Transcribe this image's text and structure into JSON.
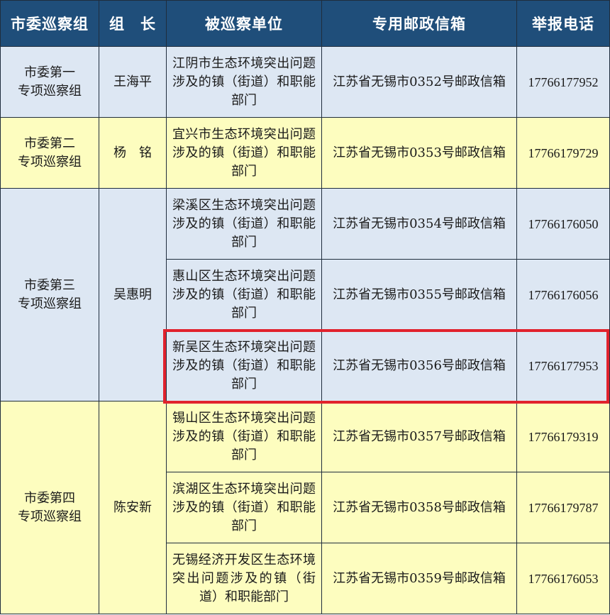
{
  "headers": {
    "group": "市委巡察组",
    "leader": "组　长",
    "unit": "被巡察单位",
    "mailbox": "专用邮政信箱",
    "phone": "举报电话"
  },
  "groups": [
    {
      "group_lines": [
        "市委第一",
        "专项巡察组"
      ],
      "leader": "王海平",
      "rows": [
        {
          "unit": "江阴市生态环境突出问题涉及的镇（街道）和职能部门",
          "mailbox": "江苏省无锡市0352号邮政信箱",
          "phone": "17766177952"
        }
      ]
    },
    {
      "group_lines": [
        "市委第二",
        "专项巡察组"
      ],
      "leader": "杨　铭",
      "rows": [
        {
          "unit": "宜兴市生态环境突出问题涉及的镇（街道）和职能部门",
          "mailbox": "江苏省无锡市0353号邮政信箱",
          "phone": "17766179729"
        }
      ]
    },
    {
      "group_lines": [
        "市委第三",
        "专项巡察组"
      ],
      "leader": "吴惠明",
      "rows": [
        {
          "unit": "梁溪区生态环境突出问题涉及的镇（街道）和职能部门",
          "mailbox": "江苏省无锡市0354号邮政信箱",
          "phone": "17766176050"
        },
        {
          "unit": "惠山区生态环境突出问题涉及的镇（街道）和职能部门",
          "mailbox": "江苏省无锡市0355号邮政信箱",
          "phone": "17766176056"
        },
        {
          "unit": "新吴区生态环境突出问题涉及的镇（街道）和职能部门",
          "mailbox": "江苏省无锡市0356号邮政信箱",
          "phone": "17766177953"
        }
      ]
    },
    {
      "group_lines": [
        "市委第四",
        "专项巡察组"
      ],
      "leader": "陈安新",
      "rows": [
        {
          "unit": "锡山区生态环境突出问题涉及的镇（街道）和职能部门",
          "mailbox": "江苏省无锡市0357号邮政信箱",
          "phone": "17766179319"
        },
        {
          "unit": "滨湖区生态环境突出问题涉及的镇（街道）和职能部门",
          "mailbox": "江苏省无锡市0358号邮政信箱",
          "phone": "17766179787"
        },
        {
          "unit": "无锡经济开发区生态环境突出问题涉及的镇（街道）和职能部门",
          "mailbox": "江苏省无锡市0359号邮政信箱",
          "phone": "17766176053"
        }
      ]
    }
  ]
}
